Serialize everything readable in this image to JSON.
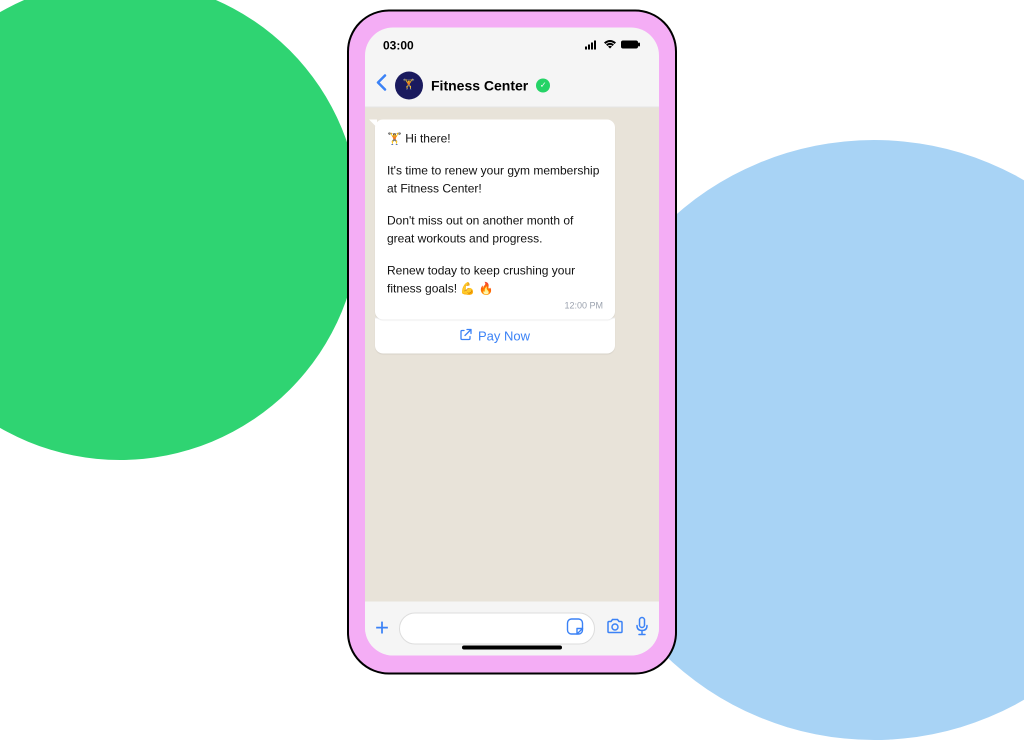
{
  "statusBar": {
    "time": "03:00"
  },
  "header": {
    "contactName": "Fitness Center"
  },
  "message": {
    "greeting": "🏋️ Hi there!",
    "line1": "It's time to renew your gym membership at Fitness Center!",
    "line2": "Don't miss out on another month of great workouts and progress.",
    "line3": "Renew today to keep crushing your fitness goals! 💪 🔥",
    "timestamp": "12:00 PM",
    "actionLabel": "Pay Now"
  }
}
